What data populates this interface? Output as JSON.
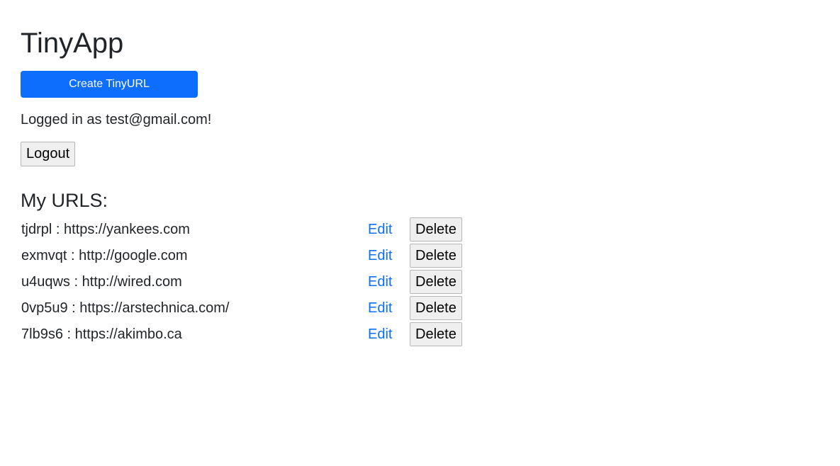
{
  "app": {
    "title": "TinyApp"
  },
  "header": {
    "create_label": "Create TinyURL",
    "logged_in_text": "Logged in as test@gmail.com!",
    "logout_label": "Logout"
  },
  "main": {
    "section_title": "My URLS:",
    "edit_label": "Edit",
    "delete_label": "Delete",
    "urls": [
      {
        "text": "tjdrpl : https://yankees.com"
      },
      {
        "text": "exmvqt : http://google.com"
      },
      {
        "text": "u4uqws : http://wired.com"
      },
      {
        "text": "0vp5u9 : https://arstechnica.com/"
      },
      {
        "text": "7lb9s6 : https://akimbo.ca"
      }
    ]
  },
  "colors": {
    "primary": "#0d6efd",
    "text": "#212529",
    "button_bg": "#efefef"
  }
}
